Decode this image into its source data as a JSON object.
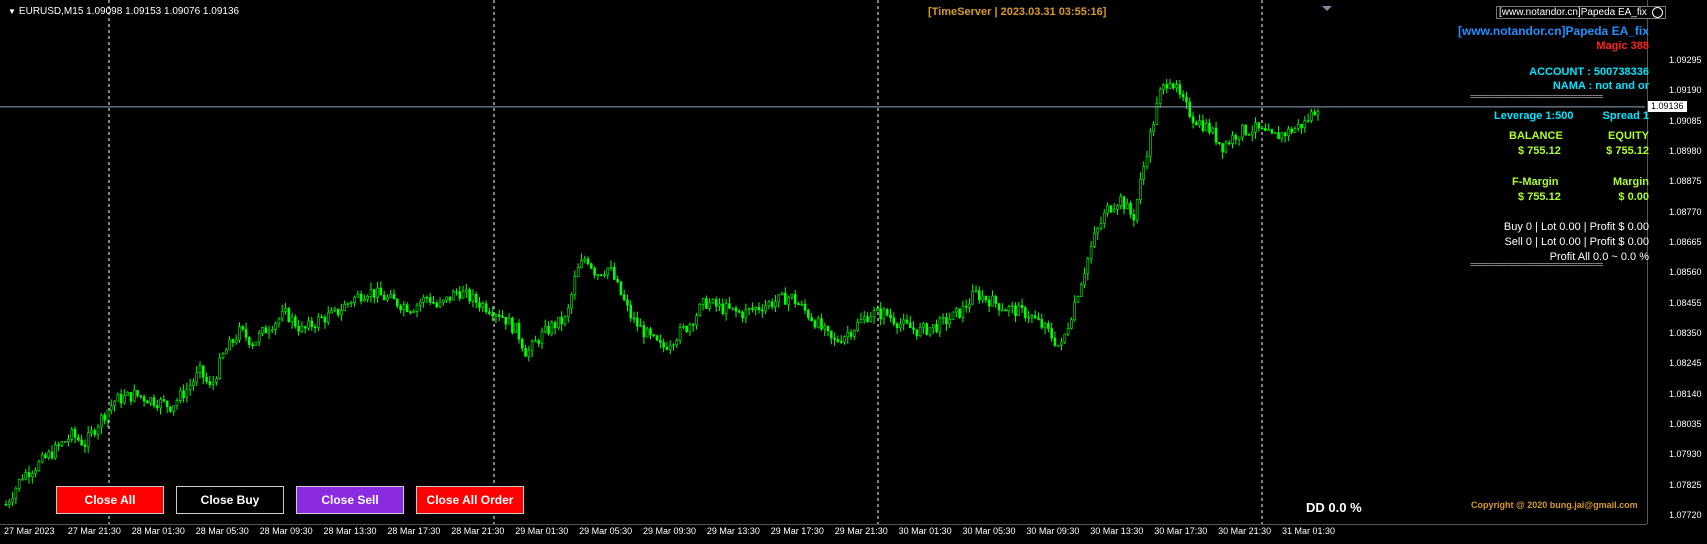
{
  "symbol_line": "EURUSD,M15  1.09098 1.09153 1.09076 1.09136",
  "time_server": "[TimeServer | 2023.03.31 03:55:16]",
  "info_box": "[www.notandor.cn]Papeda EA_fix",
  "panel": {
    "ea_name": "[www.notandor.cn]Papeda EA_fix",
    "magic": "Magic  388",
    "account": "ACCOUNT : 500738336",
    "nama": "NAMA : not and or",
    "separator": "=====================================",
    "leverage": "Leverage  1:500",
    "spread": "Spread  1",
    "balance_label": "BALANCE",
    "balance_value": "$ 755.12",
    "equity_label": "EQUITY",
    "equity_value": "$ 755.12",
    "fmargin_label": "F-Margin",
    "fmargin_value": "$ 755.12",
    "margin_label": "Margin",
    "margin_value": "$ 0.00",
    "buy_line": "Buy   0  |  Lot 0.00  |  Profit $ 0.00",
    "sell_line": "Sell   0  |  Lot 0.00  |  Profit $ 0.00",
    "profit_all": "Profit All 0.0 ~ 0.0 %"
  },
  "buttons": {
    "close_all": "Close All",
    "close_buy": "Close Buy",
    "close_sell": "Close Sell",
    "close_all_order": "Close All Order"
  },
  "dd": "DD 0.0 %",
  "copyright": "Copyright @ 2020 bung.jai@gmail.com",
  "current_price": "1.09136",
  "colors": {
    "background": "#000000",
    "candle": "#00ff00",
    "grid": "#ffffff",
    "price_line": "#8fa6c0",
    "timeserver": "#d79a2a",
    "ea_name": "#1e90ff",
    "magic": "#ff2020",
    "account": "#00e5ff",
    "balance": "#adff2f",
    "close_all_btn": "#ff0000",
    "close_buy_btn": "#000000",
    "close_sell_btn": "#8a2be2",
    "close_all_order_btn": "#ff0000"
  },
  "chart_data": {
    "type": "candlestick",
    "symbol": "EURUSD",
    "timeframe": "M15",
    "ylim": [
      1.0772,
      1.0935
    ],
    "y_ticks": [
      "1.09295",
      "1.09190",
      "1.09085",
      "1.08980",
      "1.08875",
      "1.08770",
      "1.08665",
      "1.08560",
      "1.08455",
      "1.08350",
      "1.08245",
      "1.08140",
      "1.08035",
      "1.07930",
      "1.07825",
      "1.07720"
    ],
    "x_ticks": [
      "27 Mar 2023",
      "27 Mar 21:30",
      "28 Mar 01:30",
      "28 Mar 05:30",
      "28 Mar 09:30",
      "28 Mar 13:30",
      "28 Mar 17:30",
      "28 Mar 21:30",
      "29 Mar 01:30",
      "29 Mar 05:30",
      "29 Mar 09:30",
      "29 Mar 13:30",
      "29 Mar 17:30",
      "29 Mar 21:30",
      "30 Mar 01:30",
      "30 Mar 05:30",
      "30 Mar 09:30",
      "30 Mar 13:30",
      "30 Mar 17:30",
      "30 Mar 21:30",
      "31 Mar 01:30"
    ],
    "close_path": [
      [
        0,
        1.0776
      ],
      [
        10,
        1.0786
      ],
      [
        20,
        1.079
      ],
      [
        30,
        1.0795
      ],
      [
        40,
        1.08
      ],
      [
        48,
        1.0797
      ],
      [
        58,
        1.0806
      ],
      [
        66,
        1.0812
      ],
      [
        78,
        1.0814
      ],
      [
        90,
        1.0812
      ],
      [
        100,
        1.081
      ],
      [
        110,
        1.0816
      ],
      [
        118,
        1.0822
      ],
      [
        124,
        1.0816
      ],
      [
        132,
        1.0828
      ],
      [
        142,
        1.0836
      ],
      [
        150,
        1.0832
      ],
      [
        160,
        1.0838
      ],
      [
        170,
        1.0842
      ],
      [
        180,
        1.0836
      ],
      [
        190,
        1.084
      ],
      [
        200,
        1.0842
      ],
      [
        210,
        1.0847
      ],
      [
        220,
        1.085
      ],
      [
        232,
        1.0847
      ],
      [
        246,
        1.0844
      ],
      [
        256,
        1.0848
      ],
      [
        262,
        1.0844
      ],
      [
        274,
        1.085
      ],
      [
        286,
        1.0846
      ],
      [
        300,
        1.0842
      ],
      [
        310,
        1.0836
      ],
      [
        316,
        1.0828
      ],
      [
        324,
        1.0834
      ],
      [
        332,
        1.0838
      ],
      [
        340,
        1.084
      ],
      [
        346,
        1.0856
      ],
      [
        352,
        1.0862
      ],
      [
        358,
        1.0856
      ],
      [
        366,
        1.0858
      ],
      [
        372,
        1.085
      ],
      [
        380,
        1.084
      ],
      [
        390,
        1.0834
      ],
      [
        398,
        1.083
      ],
      [
        406,
        1.0834
      ],
      [
        414,
        1.0838
      ],
      [
        424,
        1.0846
      ],
      [
        434,
        1.0844
      ],
      [
        446,
        1.0842
      ],
      [
        460,
        1.0845
      ],
      [
        476,
        1.0848
      ],
      [
        490,
        1.084
      ],
      [
        502,
        1.0832
      ],
      [
        512,
        1.0836
      ],
      [
        524,
        1.0842
      ],
      [
        534,
        1.0842
      ],
      [
        544,
        1.0838
      ],
      [
        554,
        1.0836
      ],
      [
        566,
        1.0838
      ],
      [
        580,
        1.0843
      ],
      [
        588,
        1.0849
      ],
      [
        596,
        1.0847
      ],
      [
        606,
        1.0844
      ],
      [
        620,
        1.0842
      ],
      [
        632,
        1.0836
      ],
      [
        640,
        1.083
      ]
    ],
    "current_price": 1.09136
  }
}
